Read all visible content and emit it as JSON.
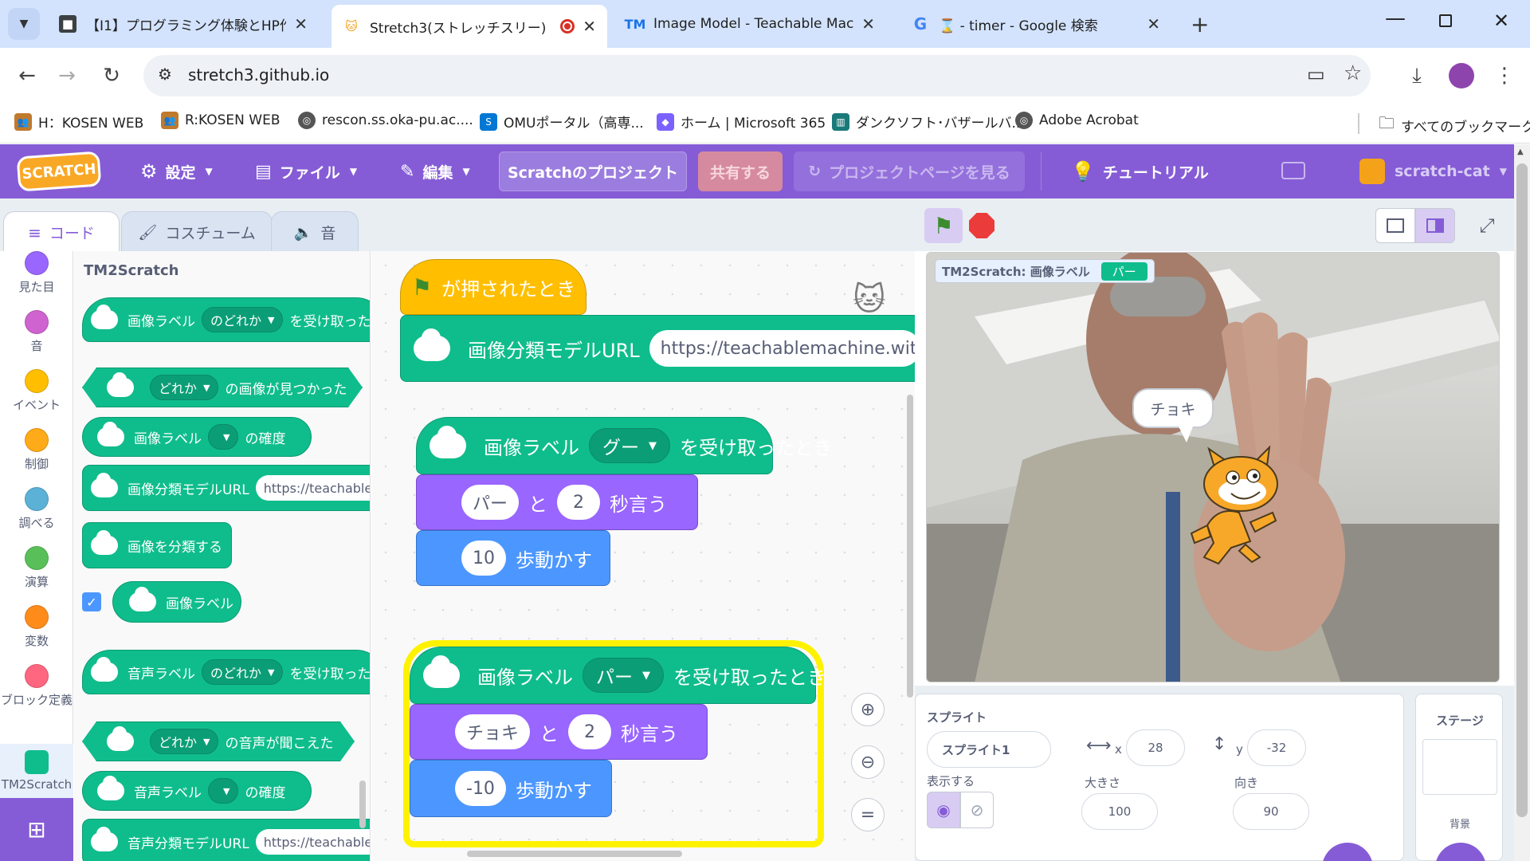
{
  "browser": {
    "tabs": [
      {
        "title": "【I1】プログラミング体験とHP作成実",
        "icon": "classroom-icon"
      },
      {
        "title": "Stretch3(ストレッチスリー)",
        "icon": "scratch-cat-icon",
        "active": true
      },
      {
        "title": "Image Model - Teachable Mach",
        "icon": "tm-icon"
      },
      {
        "title": "⌛ - timer - Google 検索",
        "icon": "google-icon"
      }
    ],
    "url": "stretch3.github.io",
    "bookmarks": [
      "H：KOSEN WEB",
      "R:KOSEN WEB",
      "rescon.ss.oka-pu.ac....",
      "OMUポータル（高専...",
      "ホーム | Microsoft 365",
      "ダンクソフト･バザールバ...",
      "Adobe Acrobat"
    ],
    "all_bookmarks": "すべてのブックマーク"
  },
  "menu": {
    "logo": "SCRATCH",
    "settings": "設定",
    "file": "ファイル",
    "edit": "編集",
    "project_title": "Scratchのプロジェクト",
    "share": "共有する",
    "project_page": "プロジェクトページを見る",
    "tutorial": "チュートリアル",
    "user": "scratch-cat"
  },
  "editor_tabs": {
    "code": "コード",
    "costume": "コスチューム",
    "sound": "音"
  },
  "categories": [
    {
      "label": "見た目",
      "color": "#9966ff"
    },
    {
      "label": "音",
      "color": "#cf63cf"
    },
    {
      "label": "イベント",
      "color": "#ffbf00"
    },
    {
      "label": "制御",
      "color": "#ffab19"
    },
    {
      "label": "調べる",
      "color": "#5cb1d6"
    },
    {
      "label": "演算",
      "color": "#59c059"
    },
    {
      "label": "変数",
      "color": "#ff8c1a"
    },
    {
      "label": "ブロック定義",
      "color": "#ff6680"
    },
    {
      "label": "TM2Scratch",
      "color": "#0fbd8c"
    }
  ],
  "palette": {
    "heading": "TM2Scratch",
    "blocks": {
      "img_when_pre": "画像ラベル",
      "img_when_dd": "のどれか",
      "img_when_post": "を受け取った",
      "img_found_dd": "どれか",
      "img_found_post": "の画像が見つかった",
      "img_conf_pre": "画像ラベル",
      "img_conf_post": "の確度",
      "img_url_label": "画像分類モデルURL",
      "img_url_val": "https://teachablem",
      "img_classify": "画像を分類する",
      "img_label_rep": "画像ラベル",
      "snd_when_pre": "音声ラベル",
      "snd_when_dd": "のどれか",
      "snd_when_post": "を受け取った",
      "snd_found_dd": "どれか",
      "snd_found_post": "の音声が聞こえた",
      "snd_conf_pre": "音声ラベル",
      "snd_conf_post": "の確度",
      "snd_url_label": "音声分類モデルURL",
      "snd_url_val": "https://teachablem"
    }
  },
  "script": {
    "flag_hat": "が押されたとき",
    "url_label": "画像分類モデルURL",
    "url_value": "https://teachablemachine.withg",
    "s1_pre": "画像ラベル",
    "s1_dd": "グー",
    "s1_post": "を受け取ったとき",
    "s1_say": "パー",
    "s1_and": "と",
    "s1_secs": "2",
    "s1_say_post": "秒言う",
    "s1_move": "10",
    "s1_move_post": "歩動かす",
    "s2_pre": "画像ラベル",
    "s2_dd": "パー",
    "s2_post": "を受け取ったとき",
    "s2_say": "チョキ",
    "s2_and": "と",
    "s2_secs": "2",
    "s2_say_post": "秒言う",
    "s2_move": "-10",
    "s2_move_post": "歩動かす"
  },
  "stage": {
    "monitor_label": "TM2Scratch: 画像ラベル",
    "monitor_value": "パー",
    "speech": "チョキ"
  },
  "sprite_panel": {
    "title": "スプライト",
    "name": "スプライト1",
    "x_label": "x",
    "x": "28",
    "y_label": "y",
    "y": "-32",
    "show_label": "表示する",
    "size_label": "大きさ",
    "size": "100",
    "direction_label": "向き",
    "direction": "90",
    "stage_label": "ステージ",
    "backdrop_label": "背景"
  }
}
